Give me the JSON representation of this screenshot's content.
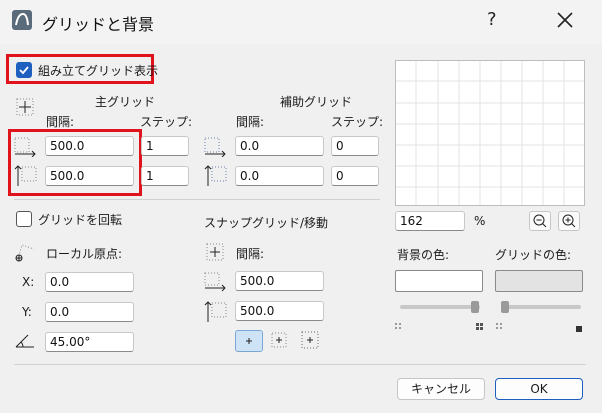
{
  "window": {
    "title": "グリッドと背景",
    "help": "?"
  },
  "assembly": {
    "label": "組み立てグリッド表示",
    "checked": true
  },
  "main_grid": {
    "header": "主グリッド",
    "spacing_label": "間隔:",
    "step_label": "ステップ:",
    "x_spacing": "500.0",
    "x_step": "1",
    "y_spacing": "500.0",
    "y_step": "1"
  },
  "aux_grid": {
    "header": "補助グリッド",
    "spacing_label": "間隔:",
    "step_label": "ステップ:",
    "x_spacing": "0.0",
    "x_step": "0",
    "y_spacing": "0.0",
    "y_step": "0"
  },
  "rotate": {
    "label": "グリッドを回転",
    "checked": false
  },
  "local_origin": {
    "label": "ローカル原点:",
    "x_label": "X:",
    "x_value": "0.0",
    "y_label": "Y:",
    "y_value": "0.0",
    "angle_value": "45.00°"
  },
  "snap": {
    "header": "スナップグリッド/移動",
    "spacing_label": "間隔:",
    "x_spacing": "500.0",
    "y_spacing": "500.0"
  },
  "zoom": {
    "value": "162",
    "unit": "%"
  },
  "colors": {
    "background_label": "背景の色:",
    "grid_label": "グリッドの色:",
    "background_color": "#ffffff",
    "grid_color": "#e3e3e3",
    "accent": "#1f5fbf",
    "highlight": "#e0121b"
  },
  "buttons": {
    "cancel": "キャンセル",
    "ok": "OK"
  }
}
